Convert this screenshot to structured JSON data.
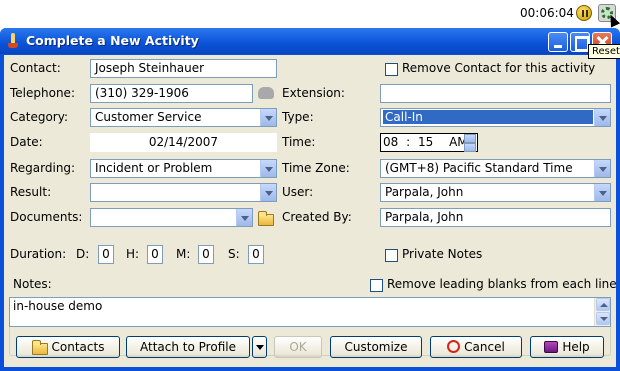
{
  "topbar": {
    "timer": "00:06:04",
    "reset_tooltip": "Reset"
  },
  "window": {
    "title": "Complete a New Activity"
  },
  "form": {
    "contact_label": "Contact:",
    "contact_value": "Joseph Steinhauer",
    "remove_contact_label": "Remove Contact for this activity",
    "telephone_label": "Telephone:",
    "telephone_value": "(310) 329-1906",
    "extension_label": "Extension:",
    "extension_value": "",
    "category_label": "Category:",
    "category_value": "Customer Service",
    "type_label": "Type:",
    "type_value": "Call-In",
    "date_label": "Date:",
    "date_value": "02/14/2007",
    "time_label": "Time:",
    "time_hour": "08",
    "time_sep": ":",
    "time_min": "15",
    "time_ampm": "AM",
    "regarding_label": "Regarding:",
    "regarding_value": "Incident or Problem",
    "timezone_label": "Time Zone:",
    "timezone_value": "(GMT+8) Pacific Standard Time",
    "result_label": "Result:",
    "result_value": "",
    "user_label": "User:",
    "user_value": "Parpala, John",
    "documents_label": "Documents:",
    "documents_value": "",
    "created_by_label": "Created By:",
    "created_by_value": "Parpala, John",
    "duration_label": "Duration:",
    "d_label": "D:",
    "d_value": "0",
    "h_label": "H:",
    "h_value": "0",
    "m_label": "M:",
    "m_value": "0",
    "s_label": "S:",
    "s_value": "0",
    "private_notes_label": "Private Notes",
    "notes_label": "Notes:",
    "remove_blanks_label": "Remove leading blanks from each line",
    "notes_value": "in-house demo"
  },
  "buttons": {
    "contacts": "Contacts",
    "attach": "Attach to Profile",
    "ok": "OK",
    "customize": "Customize",
    "cancel": "Cancel",
    "help": "Help"
  },
  "colors": {
    "titlebar": "#0a52d8",
    "selection": "#316ac5",
    "face": "#ece9d8"
  }
}
